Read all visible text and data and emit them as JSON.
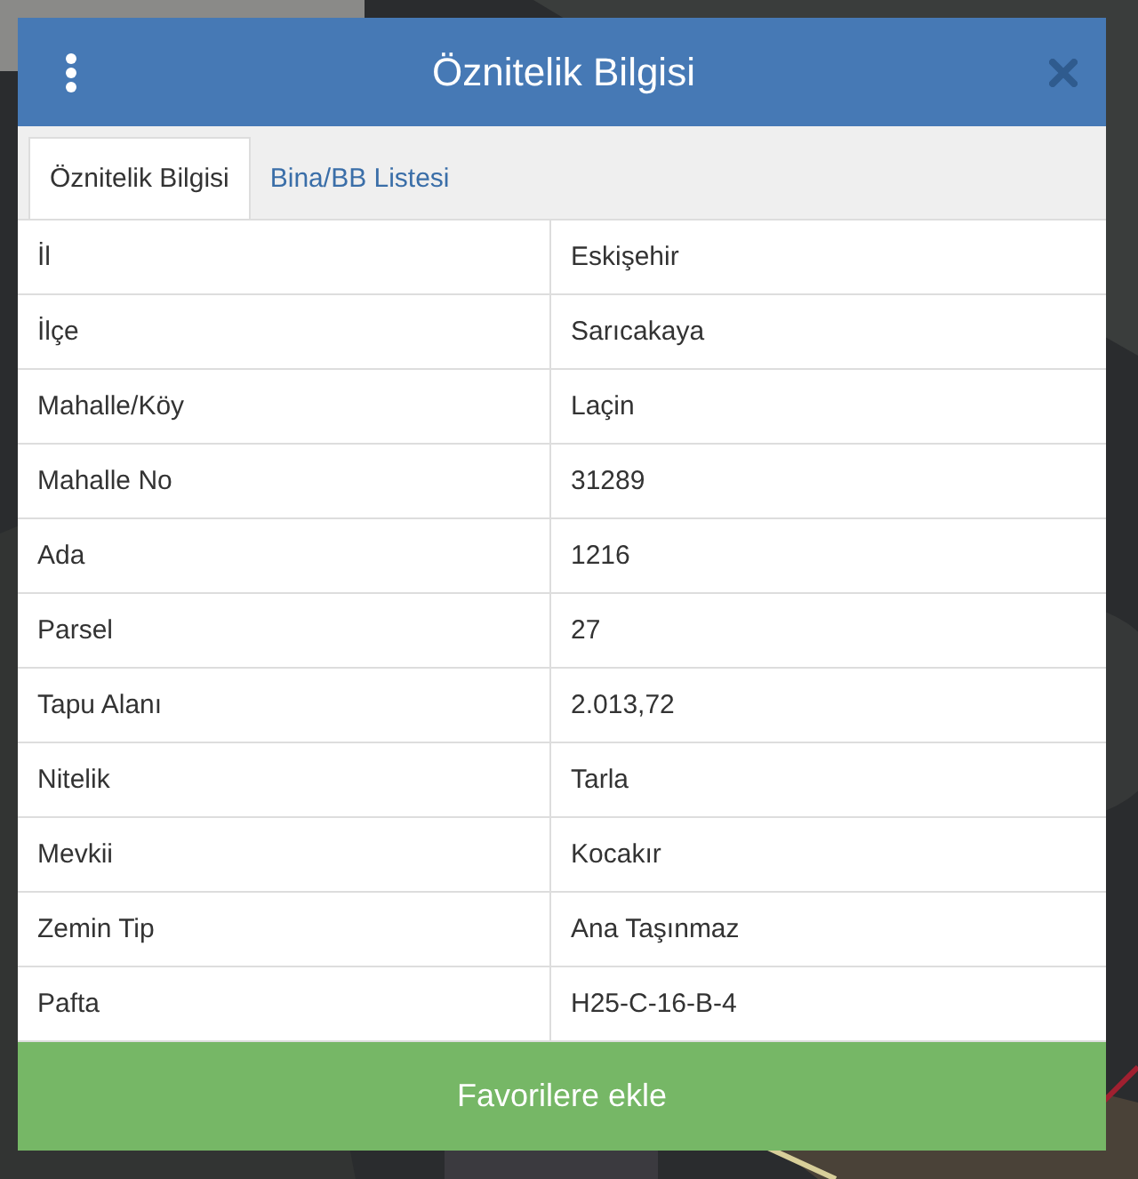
{
  "dialog": {
    "title": "Öznitelik Bilgisi"
  },
  "tabs": [
    {
      "label": "Öznitelik Bilgisi",
      "selected": true
    },
    {
      "label": "Bina/BB Listesi",
      "selected": false
    }
  ],
  "rows": [
    {
      "label": "İl",
      "value": "Eskişehir"
    },
    {
      "label": "İlçe",
      "value": "Sarıcakaya"
    },
    {
      "label": "Mahalle/Köy",
      "value": "Laçin"
    },
    {
      "label": "Mahalle No",
      "value": "31289"
    },
    {
      "label": "Ada",
      "value": "1216"
    },
    {
      "label": "Parsel",
      "value": "27"
    },
    {
      "label": "Tapu Alanı",
      "value": "2.013,72"
    },
    {
      "label": "Nitelik",
      "value": "Tarla"
    },
    {
      "label": "Mevkii",
      "value": "Kocakır"
    },
    {
      "label": "Zemin Tip",
      "value": "Ana Taşınmaz"
    },
    {
      "label": "Pafta",
      "value": "H25-C-16-B-4"
    }
  ],
  "button": {
    "label": "Favorilere ekle"
  }
}
